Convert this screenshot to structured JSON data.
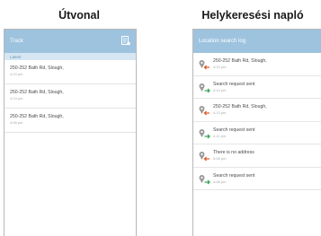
{
  "titles": {
    "left": "Útvonal",
    "right": "Helykeresési napló"
  },
  "left_phone": {
    "appbar_title": "Track",
    "subbar_label": "Latest",
    "menu_icon": "log-list-icon",
    "items": [
      {
        "address": "250-252 Bath Rd, Slough,",
        "time": "4:13 pm"
      },
      {
        "address": "250-252 Bath Rd, Slough,",
        "time": "4:13 pm"
      },
      {
        "address": "250-252 Bath Rd, Slough,",
        "time": "4:08 pm"
      }
    ]
  },
  "right_phone": {
    "appbar_title": "Location search log",
    "items": [
      {
        "text": "250-252 Bath Rd, Slough,",
        "time": "4:13 pm",
        "icon": "pin-arrow-in-icon",
        "arrow_color": "#e05a2b"
      },
      {
        "text": "Search request sent",
        "time": "4:13 pm",
        "icon": "pin-arrow-out-icon",
        "arrow_color": "#3aa757"
      },
      {
        "text": "250-252 Bath Rd, Slough,",
        "time": "4:13 pm",
        "icon": "pin-arrow-in-icon",
        "arrow_color": "#e05a2b"
      },
      {
        "text": "Search request sent",
        "time": "4:11 pm",
        "icon": "pin-arrow-out-icon",
        "arrow_color": "#3aa757"
      },
      {
        "text": "There is no address",
        "time": "4:08 pm",
        "icon": "pin-arrow-in-icon",
        "arrow_color": "#e05a2b"
      },
      {
        "text": "Search request sent",
        "time": "4:08 pm",
        "icon": "pin-arrow-out-icon",
        "arrow_color": "#3aa757"
      }
    ]
  },
  "colors": {
    "appbar": "#9ec3df",
    "subbar": "#d6e7f3"
  }
}
